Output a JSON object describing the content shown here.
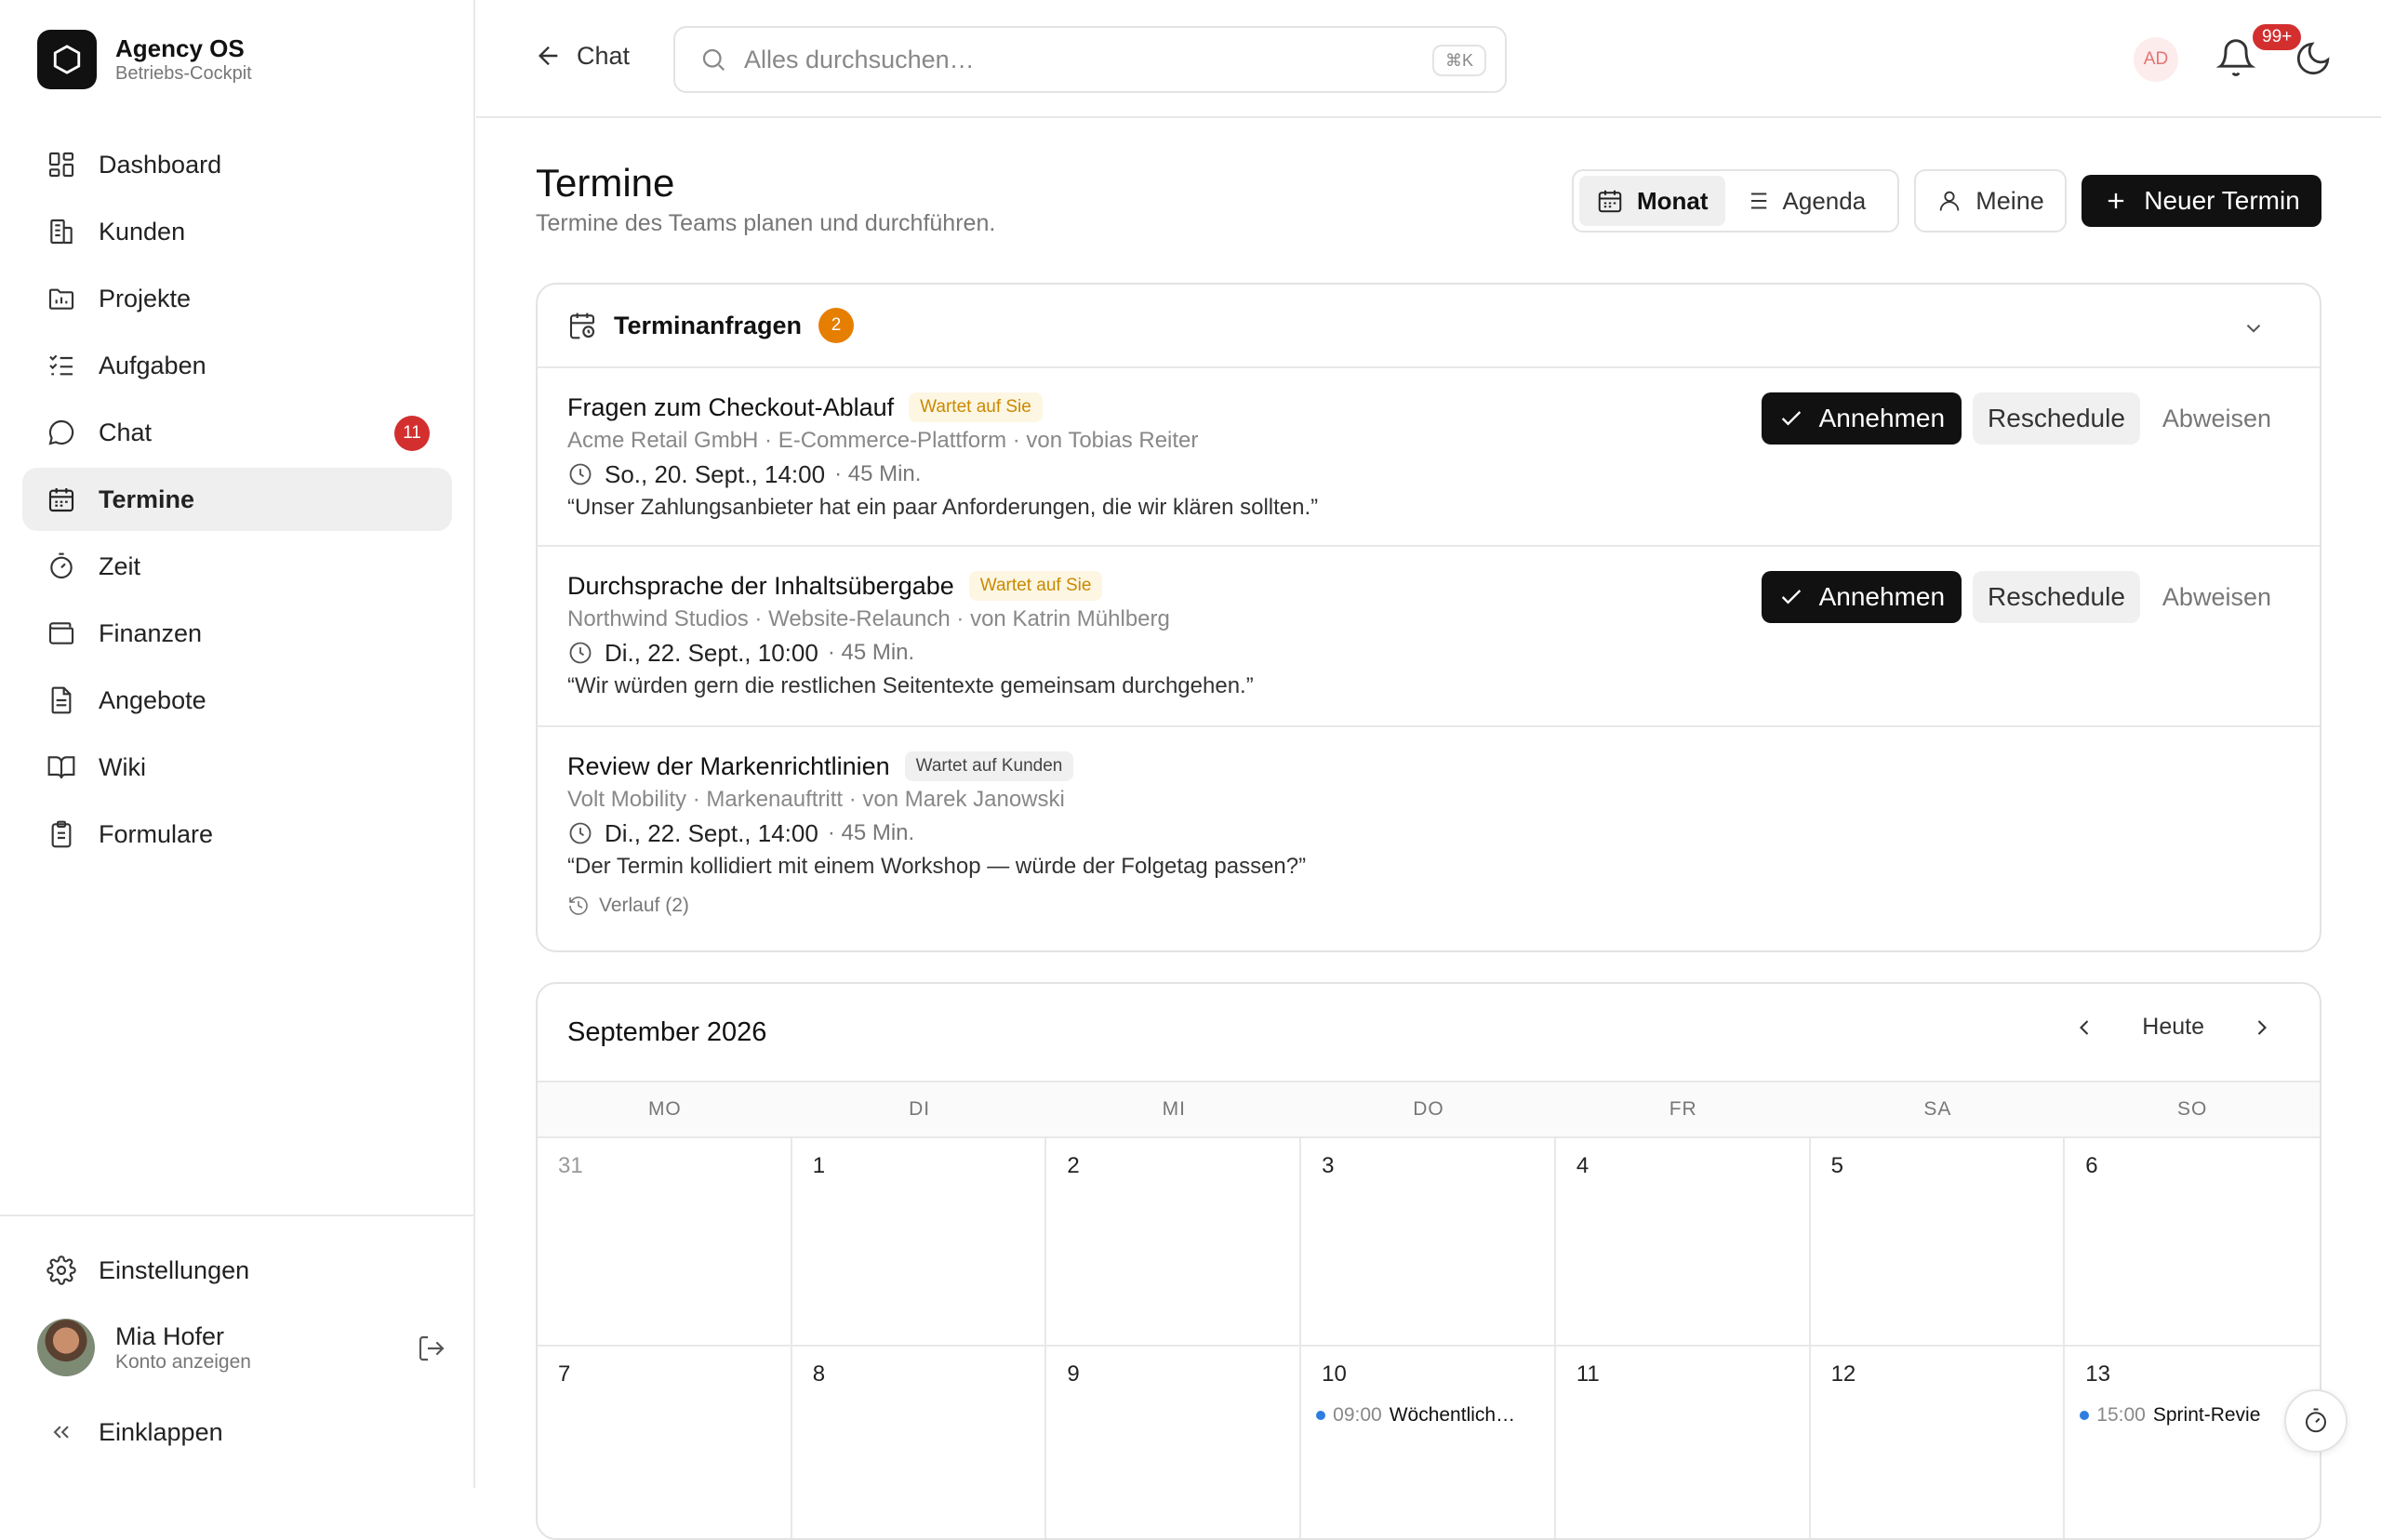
{
  "brand": {
    "title": "Agency OS",
    "subtitle": "Betriebs-Cockpit"
  },
  "sidebar": {
    "items": [
      {
        "label": "Dashboard",
        "icon": "dashboard-icon"
      },
      {
        "label": "Kunden",
        "icon": "building-icon"
      },
      {
        "label": "Projekte",
        "icon": "folder-icon"
      },
      {
        "label": "Aufgaben",
        "icon": "tasks-icon"
      },
      {
        "label": "Chat",
        "icon": "chat-icon",
        "badge": "11"
      },
      {
        "label": "Termine",
        "icon": "calendar-icon",
        "active": true
      },
      {
        "label": "Zeit",
        "icon": "timer-icon"
      },
      {
        "label": "Finanzen",
        "icon": "wallet-icon"
      },
      {
        "label": "Angebote",
        "icon": "document-icon"
      },
      {
        "label": "Wiki",
        "icon": "book-icon"
      },
      {
        "label": "Formulare",
        "icon": "clipboard-icon"
      }
    ],
    "settings_label": "Einstellungen",
    "user": {
      "name": "Mia Hofer",
      "sub": "Konto anzeigen"
    },
    "collapse_label": "Einklappen"
  },
  "topbar": {
    "back_label": "Chat",
    "search_placeholder": "Alles durchsuchen…",
    "search_shortcut": "⌘K",
    "user_initials": "AD",
    "notification_count": "99+"
  },
  "page": {
    "title": "Termine",
    "subtitle": "Termine des Teams planen und durchführen.",
    "view_month": "Monat",
    "view_agenda": "Agenda",
    "mine_label": "Meine",
    "new_label": "Neuer Termin"
  },
  "requests": {
    "title": "Terminanfragen",
    "count": "2",
    "accept_label": "Annehmen",
    "reschedule_label": "Reschedule",
    "decline_label": "Abweisen",
    "items": [
      {
        "title": "Fragen zum Checkout-Ablauf",
        "status": "Wartet auf Sie",
        "meta": "Acme Retail GmbH · E-Commerce-Plattform · von Tobias Reiter",
        "time": "So., 20. Sept., 14:00",
        "duration": "· 45 Min.",
        "quote": "“Unser Zahlungsanbieter hat ein paar Anforderungen, die wir klären sollten.”"
      },
      {
        "title": "Durchsprache der Inhaltsübergabe",
        "status": "Wartet auf Sie",
        "meta": "Northwind Studios · Website-Relaunch · von Katrin Mühlberg",
        "time": "Di., 22. Sept., 10:00",
        "duration": "· 45 Min.",
        "quote": "“Wir würden gern die restlichen Seitentexte gemeinsam durchgehen.”"
      },
      {
        "title": "Review der Markenrichtlinien",
        "status": "Wartet auf Kunden",
        "meta": "Volt Mobility · Markenauftritt · von Marek Janowski",
        "time": "Di., 22. Sept., 14:00",
        "duration": "· 45 Min.",
        "quote": "“Der Termin kollidiert mit einem Workshop — würde der Folgetag passen?”",
        "history": "Verlauf (2)"
      }
    ]
  },
  "calendar": {
    "month_label": "September 2026",
    "today_label": "Heute",
    "weekdays": [
      "MO",
      "DI",
      "MI",
      "DO",
      "FR",
      "SA",
      "SO"
    ],
    "days": [
      "31",
      "1",
      "2",
      "3",
      "4",
      "5",
      "6",
      "7",
      "8",
      "9",
      "10",
      "11",
      "12",
      "13"
    ],
    "events": [
      {
        "day_index": 10,
        "time": "09:00",
        "name": "Wöchentlich…"
      },
      {
        "day_index": 13,
        "time": "15:00",
        "name": "Sprint-Revie"
      }
    ],
    "event_color": "#2f7de1"
  },
  "colors": {
    "accent": "#111111",
    "badge_red": "#d32f2f",
    "badge_orange": "#e67e00",
    "tag_yellow": "#c98a00"
  }
}
